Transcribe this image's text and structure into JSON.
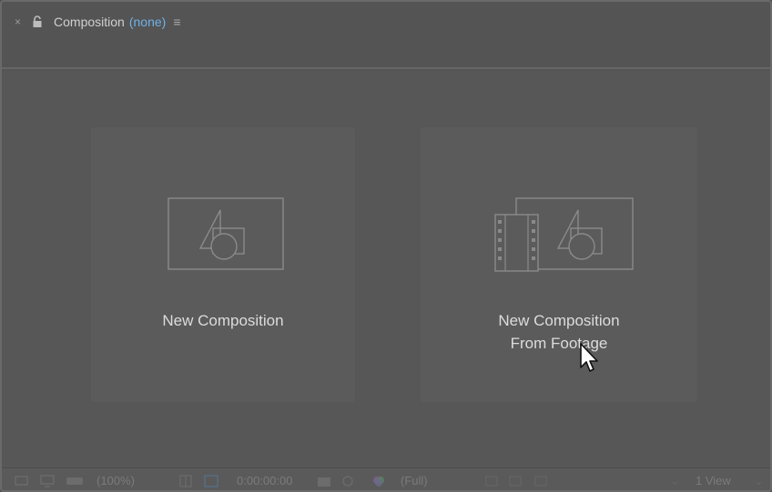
{
  "tab": {
    "close_glyph": "×",
    "title": "Composition",
    "composition_name": "(none)",
    "menu_glyph": "≡"
  },
  "cards": [
    {
      "label_lines": [
        "New Composition"
      ],
      "icon": "composition-icon"
    },
    {
      "label_lines": [
        "New Composition",
        "From Footage"
      ],
      "icon": "composition-from-footage-icon"
    }
  ],
  "footer": {
    "zoom": "(100%)",
    "timecode": "0:00:00:00",
    "resolution": "(Full)",
    "views": "1 View"
  },
  "colors": {
    "panel_bg": "#545454",
    "composition_name": "#6fb1e6",
    "label_text": "#dcdcdc"
  }
}
